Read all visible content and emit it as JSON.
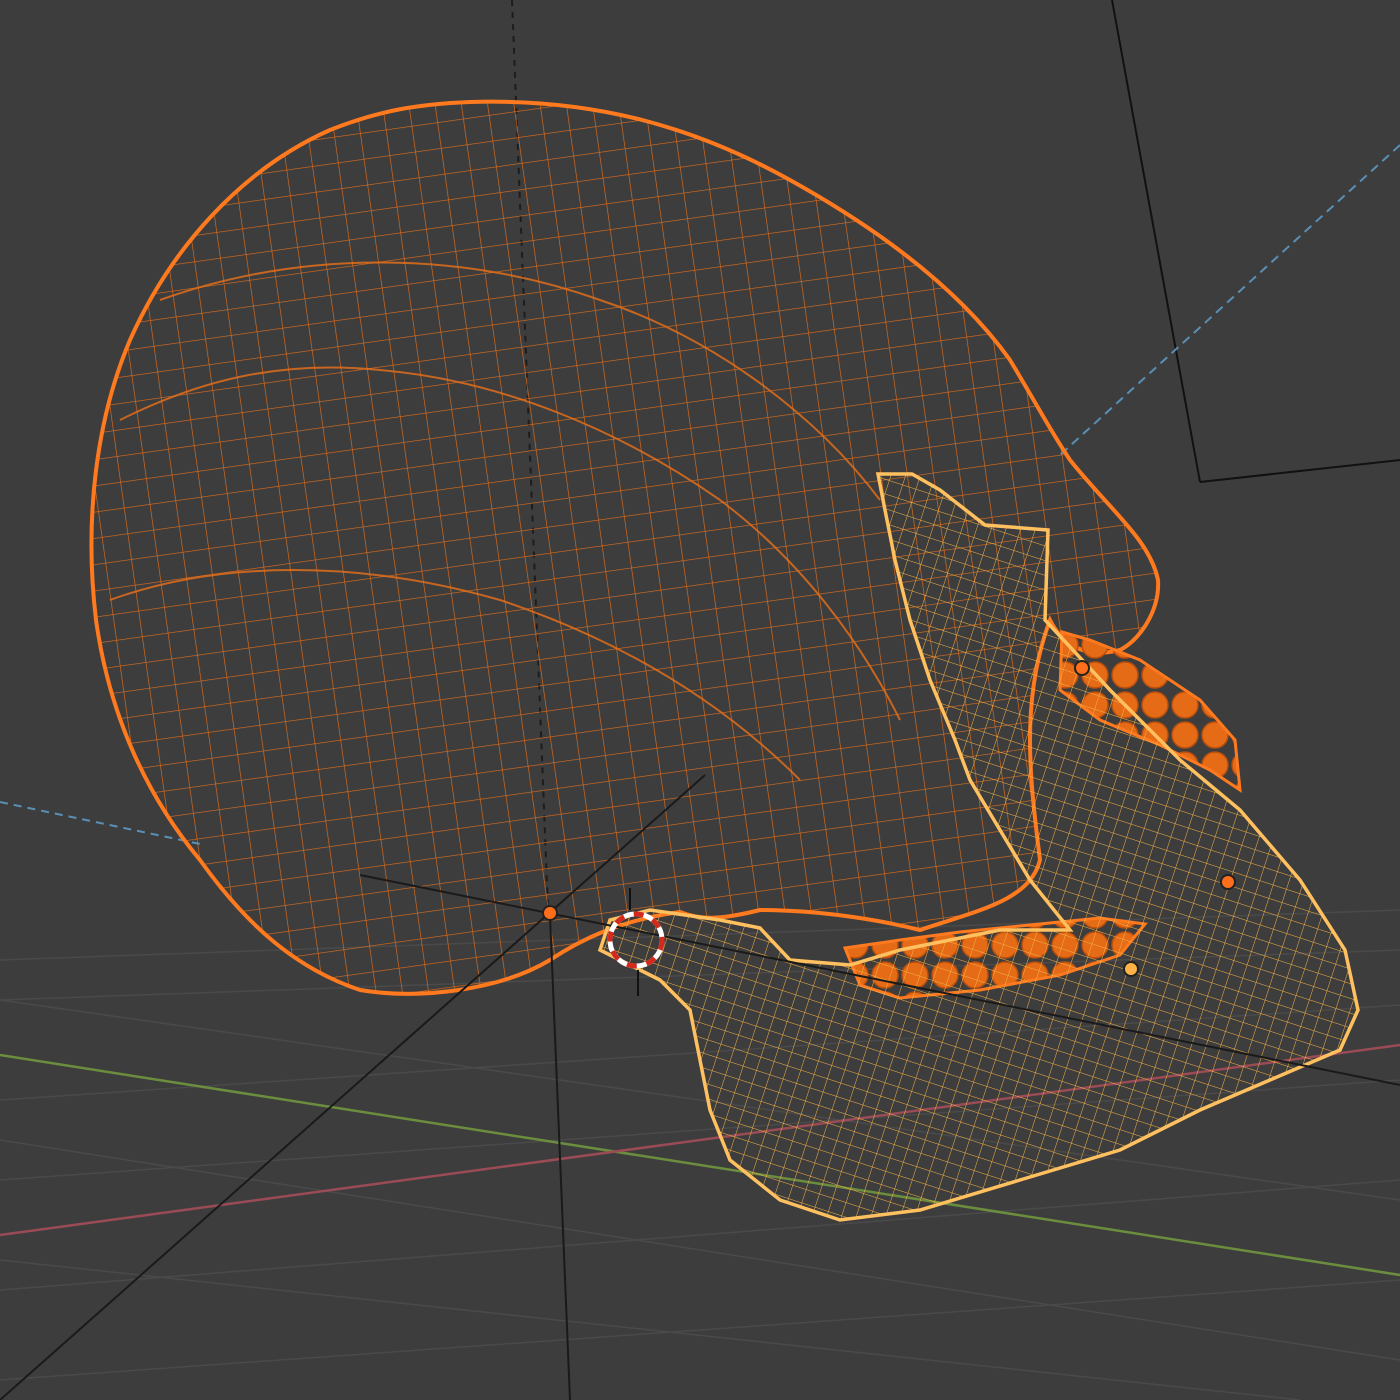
{
  "viewport": {
    "mode": "wireframe",
    "background_color": "#3d3d3d",
    "grid_color": "#4a4a4a",
    "x_axis_color": "#9a4b56",
    "y_axis_color": "#6b8e3e"
  },
  "objects": [
    {
      "name": "skull-cranium",
      "selected": true,
      "active": false,
      "wire_color": "#e8701a",
      "fill_color": "#e56b17"
    },
    {
      "name": "teeth",
      "selected": true,
      "active": false,
      "wire_color": "#e8701a",
      "fill_color": "#e56b17"
    },
    {
      "name": "mandible",
      "selected": true,
      "active": true,
      "wire_color": "#f5b347",
      "fill_color": "#f2a93d"
    }
  ],
  "origins": [
    {
      "name": "cranium-origin",
      "color": "#ff6e1a"
    },
    {
      "name": "teeth-origin",
      "color": "#ff6e1a"
    },
    {
      "name": "mandible-origin",
      "color": "#ff6e1a"
    },
    {
      "name": "mandible-origin-2",
      "color": "#ffb347"
    },
    {
      "name": "world-origin",
      "color": "#ff6e1a"
    }
  ],
  "cursor_3d": {
    "ring_colors": [
      "#d42a1e",
      "#ffffff"
    ]
  }
}
